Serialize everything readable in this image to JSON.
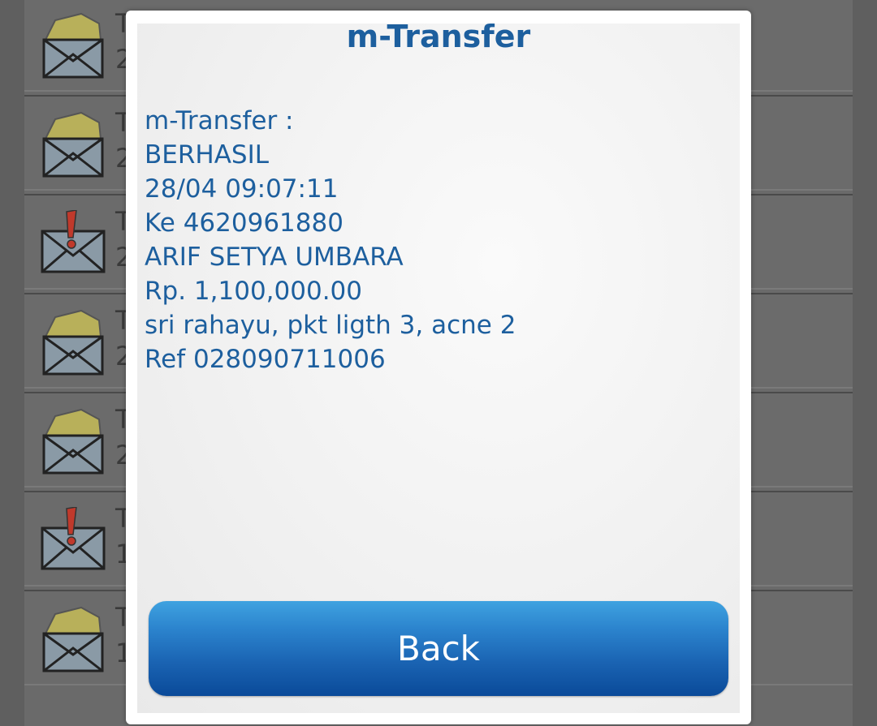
{
  "dialog": {
    "title": "m-Transfer",
    "message_lines": [
      "m-Transfer :",
      "BERHASIL",
      "28/04 09:07:11",
      "Ke 4620961880",
      "ARIF SETYA UMBARA",
      "Rp. 1,100,000.00",
      "sri rahayu, pkt ligth 3, acne 2",
      "Ref 028090711006"
    ],
    "back_label": "Back"
  },
  "inbox": {
    "rows": [
      {
        "icon": "envelope-open-icon",
        "initial": "T",
        "sub": "2"
      },
      {
        "icon": "envelope-open-icon",
        "initial": "T",
        "sub": "2"
      },
      {
        "icon": "envelope-alert-icon",
        "initial": "T",
        "sub": "2"
      },
      {
        "icon": "envelope-open-icon",
        "initial": "T",
        "sub": "2"
      },
      {
        "icon": "envelope-open-icon",
        "initial": "T",
        "sub": "2"
      },
      {
        "icon": "envelope-alert-icon",
        "initial": "T",
        "sub": "1"
      },
      {
        "icon": "envelope-open-icon",
        "initial": "T",
        "sub": "1"
      }
    ]
  },
  "colors": {
    "accent_text": "#1d5f9e",
    "button_top": "#3fa2e0",
    "button_bottom": "#0a4a99",
    "overlay_bg": "#5f5f5f"
  }
}
